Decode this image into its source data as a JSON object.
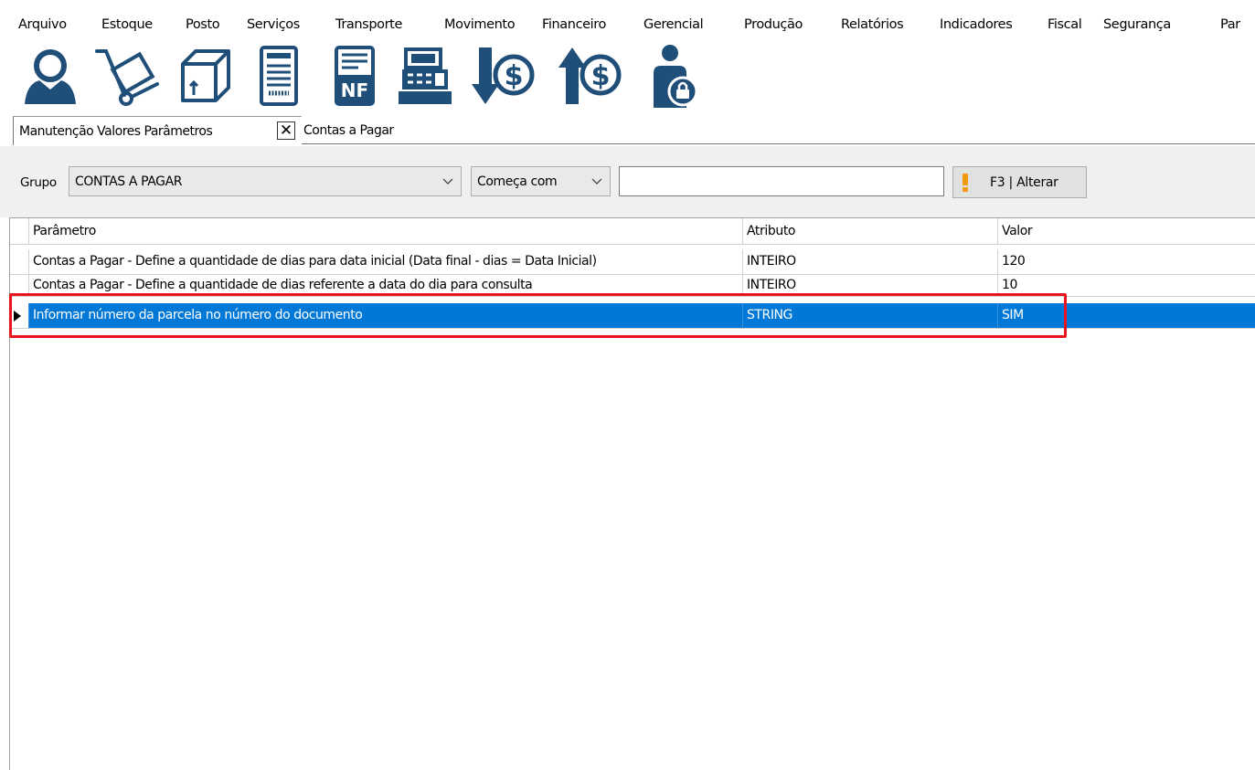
{
  "menu": {
    "items": [
      "Arquivo",
      "Estoque",
      "Posto",
      "Serviços",
      "Transporte",
      "Movimento",
      "Financeiro",
      "Gerencial",
      "Produção",
      "Relatórios",
      "Indicadores",
      "Fiscal",
      "Segurança",
      "Par"
    ]
  },
  "toolbar": {
    "buttons": [
      {
        "icon": "user-icon"
      },
      {
        "icon": "hand-truck-icon"
      },
      {
        "icon": "box-icon"
      },
      {
        "icon": "document-icon"
      },
      {
        "icon": "invoice-nf-icon"
      },
      {
        "icon": "cash-register-icon"
      },
      {
        "icon": "money-down-icon"
      },
      {
        "icon": "money-up-icon"
      },
      {
        "icon": "user-lock-icon"
      }
    ],
    "nf_label": "NF"
  },
  "tabs": [
    {
      "label": "Manutenção Valores Parâmetros",
      "active": true
    },
    {
      "label": "Contas a Pagar",
      "active": false
    }
  ],
  "filter": {
    "grupo_label": "Grupo",
    "grupo_value": "CONTAS A PAGAR",
    "match_value": "Começa com",
    "search_value": "",
    "alter_label": "F3 | Alterar",
    "accent_color": "#f39c12"
  },
  "grid": {
    "columns": [
      "Parâmetro",
      "Atributo",
      "Valor"
    ],
    "rows": [
      {
        "parametro": "Contas a Pagar - Define a quantidade de dias para data inicial (Data final - dias = Data Inicial)",
        "atributo": "INTEIRO",
        "valor": "120"
      },
      {
        "parametro": "Contas a Pagar - Define a quantidade de dias referente a data do dia para consulta",
        "atributo": "INTEIRO",
        "valor": "10"
      },
      {
        "parametro": "Informar número da parcela no número do documento",
        "atributo": "STRING",
        "valor": "SIM"
      }
    ],
    "selected_row": 2,
    "selection_color": "#0078d7",
    "highlight_color": "#e8141e"
  }
}
